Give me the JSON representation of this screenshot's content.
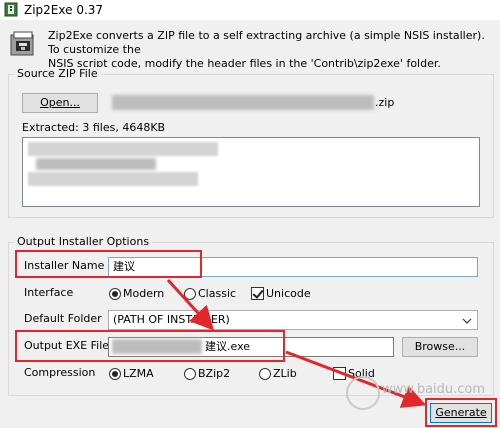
{
  "window": {
    "title": "Zip2Exe 0.37"
  },
  "description": {
    "line1": "Zip2Exe converts a ZIP file to a self extracting archive (a simple NSIS installer). To customize the",
    "line2": "NSIS script code, modify the header files in the 'Contrib\\zip2exe' folder."
  },
  "source_zip": {
    "group_label": "Source ZIP File",
    "open_button": "Open...",
    "zip_suffix": ".zip",
    "extracted_text": "Extracted: 3 files, 4648KB"
  },
  "output_options": {
    "group_label": "Output Installer Options",
    "installer_name_label": "Installer Name",
    "installer_name_value": "建议",
    "interface_label": "Interface",
    "interface_options": [
      "Modern",
      "Classic"
    ],
    "interface_selected": "Modern",
    "unicode_label": "Unicode",
    "unicode_checked": true,
    "default_folder_label": "Default Folder",
    "default_folder_value": "(PATH OF INSTALLER)",
    "output_exe_label": "Output EXE File",
    "output_exe_value": "建议.exe",
    "browse_button": "Browse...",
    "compression_label": "Compression",
    "compression_options": [
      "LZMA",
      "BZip2",
      "ZLib"
    ],
    "compression_selected": "LZMA",
    "solid_label": "Solid",
    "solid_checked": false
  },
  "generate_button": "Generate",
  "watermark": "www.baidu.com",
  "colors": {
    "annotation_red": "#e3262b",
    "window_bg": "#f0f0f0"
  },
  "icons": [
    "app-icon",
    "zip-archive-icon"
  ]
}
